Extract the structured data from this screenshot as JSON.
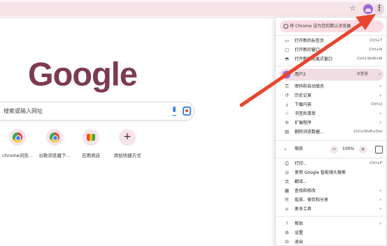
{
  "toolbar": {
    "star_icon": "☆",
    "menu_icon": "⋮"
  },
  "ntp": {
    "logo": "Google",
    "search_placeholder": "搜索或输入网址",
    "shortcuts": [
      {
        "label": "chrome浏览..."
      },
      {
        "label": "谷歌浏览器下..."
      },
      {
        "label": "应用商店"
      },
      {
        "label": "添加快捷方式"
      }
    ]
  },
  "menu": {
    "banner": "将 Chrome 设为您的默认浏览器",
    "new_tab": "打开新的标签页",
    "new_tab_sc": "Ctrl+T",
    "new_window": "打开新的窗口",
    "new_window_sc": "Ctrl+N",
    "incognito": "打开新的无痕式窗口",
    "incognito_sc": "Ctrl+Shift+N",
    "profile_name": "用户2",
    "profile_status": "未登录",
    "passwords": "密码和自动填充",
    "history": "历史记录",
    "downloads": "下载内容",
    "downloads_sc": "Ctrl+J",
    "bookmarks": "书签和清单",
    "extensions": "扩展程序",
    "clear_data": "删除浏览数据...",
    "clear_data_sc": "Ctrl+Shift+Del",
    "zoom_label": "缩放",
    "zoom_minus": "−",
    "zoom_value": "100%",
    "zoom_plus": "+",
    "print": "打印...",
    "print_sc": "Ctrl+P",
    "google_lens": "使用 Google 智能镜头搜索",
    "translate": "翻译...",
    "find_edit": "查找和修改",
    "cast_save_share": "投放、保存和分享",
    "more_tools": "更多工具",
    "help": "帮助",
    "settings": "设置",
    "exit": "退出"
  },
  "colors": {
    "logo": "#7d3b4f",
    "annotation_arrow": "#e8452f",
    "banner_bg": "#f9dce4"
  }
}
